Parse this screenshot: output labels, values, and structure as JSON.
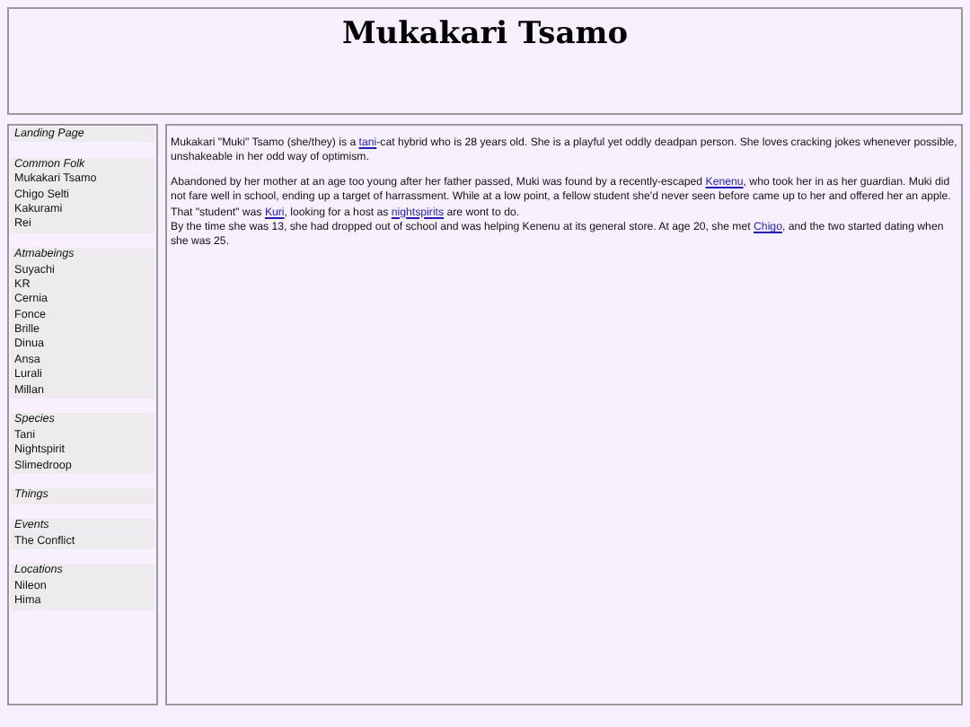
{
  "header": {
    "title": "Mukakari Tsamo"
  },
  "sidebar": {
    "sections": [
      {
        "heading": "Landing Page"
      },
      {
        "heading": "Common Folk",
        "items": [
          "Mukakari Tsamo",
          "Chigo Selti",
          "Kakurami",
          "Rei"
        ]
      },
      {
        "heading": "Atmabeings",
        "items": [
          "Suyachi",
          "KR",
          "Cernia",
          "Fonce",
          "Brille",
          "Dinua",
          "Ansa",
          "Lurali",
          "Millan"
        ]
      },
      {
        "heading": "Species",
        "items": [
          "Tani",
          "Nightspirit",
          "Slimedroop"
        ]
      },
      {
        "heading": "Things"
      },
      {
        "heading": "Events",
        "items": [
          "The Conflict"
        ]
      },
      {
        "heading": "Locations",
        "items": [
          "Nileon",
          "Hima"
        ]
      }
    ]
  },
  "article": {
    "paragraphs": [
      {
        "lines": [
          [
            {
              "text": "Mukakari \"Muki\" Tsamo (she/they) is a "
            },
            {
              "link": "tani"
            },
            {
              "text": "-cat hybrid who is 28 years old. She is a playful yet oddly deadpan person. She loves cracking jokes whenever possible, unshakeable in her odd way of optimism."
            }
          ]
        ]
      },
      {
        "lines": [
          [
            {
              "text": "Abandoned by her mother at an age too young after her father passed, Muki was found by a recently-escaped "
            },
            {
              "link": "Kenenu"
            },
            {
              "text": ", who took her in as her guardian. Muki did not fare well in school, ending up a target of harrassment. While at a low point, a fellow student she'd never seen before came up to her and offered her an apple. That \"student\" was "
            },
            {
              "link": "Kuri"
            },
            {
              "text": ", looking for a host as "
            },
            {
              "link": "nightspirits"
            },
            {
              "text": " are wont to do."
            }
          ],
          [
            {
              "text": "By the time she was 13, she had dropped out of school and was helping Kenenu at its general store. At age 20, she met "
            },
            {
              "link": "Chigo"
            },
            {
              "text": ", and the two started dating when she was 25."
            }
          ]
        ]
      }
    ]
  }
}
